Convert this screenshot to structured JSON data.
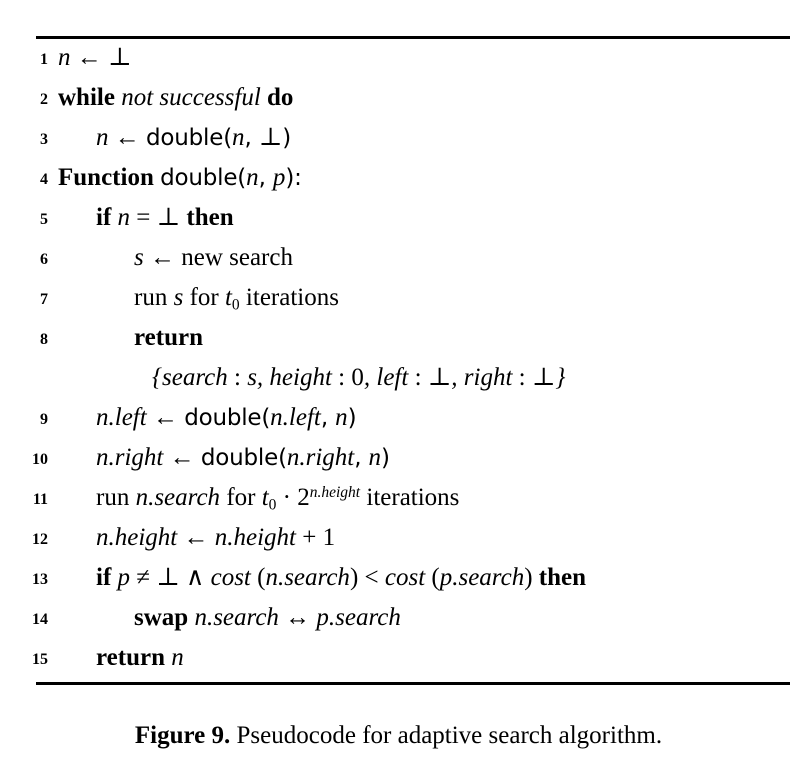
{
  "figure": {
    "caption_label": "Figure 9.",
    "caption_text": "Pseudocode for adaptive search algorithm.",
    "rule_color": "#000000"
  },
  "algorithm": {
    "lines": [
      {
        "number": "1",
        "indent": 0,
        "plain": "n ← ⊥",
        "tokens": [
          {
            "t": "var",
            "v": "n"
          },
          {
            "t": "op",
            "v": " ← "
          },
          {
            "t": "op",
            "v": "⊥"
          }
        ]
      },
      {
        "number": "2",
        "indent": 0,
        "plain": "while not successful do",
        "tokens": [
          {
            "t": "kw",
            "v": "while"
          },
          {
            "t": "rom",
            "v": " "
          },
          {
            "t": "var",
            "v": "not successful"
          },
          {
            "t": "rom",
            "v": " "
          },
          {
            "t": "kw",
            "v": "do"
          }
        ]
      },
      {
        "number": "3",
        "indent": 1,
        "plain": "n ← double(n, ⊥)",
        "tokens": [
          {
            "t": "var",
            "v": "n"
          },
          {
            "t": "op",
            "v": " ← "
          },
          {
            "t": "fn",
            "v": "double("
          },
          {
            "t": "var",
            "v": "n"
          },
          {
            "t": "fn",
            "v": ", "
          },
          {
            "t": "op",
            "v": "⊥"
          },
          {
            "t": "fn",
            "v": ")"
          }
        ]
      },
      {
        "number": "4",
        "indent": 0,
        "plain": "Function double(n, p):",
        "tokens": [
          {
            "t": "kw",
            "v": "Function"
          },
          {
            "t": "rom",
            "v": " "
          },
          {
            "t": "fn",
            "v": "double("
          },
          {
            "t": "var",
            "v": "n"
          },
          {
            "t": "fn",
            "v": ", "
          },
          {
            "t": "var",
            "v": "p"
          },
          {
            "t": "fn",
            "v": "):"
          }
        ]
      },
      {
        "number": "5",
        "indent": 1,
        "plain": "if n = ⊥ then",
        "tokens": [
          {
            "t": "kw",
            "v": "if"
          },
          {
            "t": "rom",
            "v": " "
          },
          {
            "t": "var",
            "v": "n"
          },
          {
            "t": "op",
            "v": " = "
          },
          {
            "t": "op",
            "v": "⊥"
          },
          {
            "t": "rom",
            "v": " "
          },
          {
            "t": "kw",
            "v": "then"
          }
        ]
      },
      {
        "number": "6",
        "indent": 2,
        "plain": "s ← new search",
        "tokens": [
          {
            "t": "var",
            "v": "s"
          },
          {
            "t": "op",
            "v": " ← "
          },
          {
            "t": "rom",
            "v": "new search"
          }
        ]
      },
      {
        "number": "7",
        "indent": 2,
        "plain": "run s for t₀ iterations",
        "tokens": [
          {
            "t": "rom",
            "v": "run "
          },
          {
            "t": "var",
            "v": "s"
          },
          {
            "t": "rom",
            "v": " for "
          },
          {
            "t": "var",
            "v": "t"
          },
          {
            "t": "sub",
            "v": "0"
          },
          {
            "t": "rom",
            "v": " iterations"
          }
        ]
      },
      {
        "number": "8",
        "indent": 2,
        "plain": "return",
        "tokens": [
          {
            "t": "kw",
            "v": "return"
          }
        ]
      },
      {
        "number": "",
        "indent": "2b",
        "continuation": true,
        "plain": "{search : s, height : 0, left : ⊥, right : ⊥}",
        "tokens": [
          {
            "t": "var",
            "v": "{search"
          },
          {
            "t": "op",
            "v": " : "
          },
          {
            "t": "var",
            "v": "s"
          },
          {
            "t": "var",
            "v": ", "
          },
          {
            "t": "var",
            "v": "height"
          },
          {
            "t": "op",
            "v": " : "
          },
          {
            "t": "num",
            "v": "0"
          },
          {
            "t": "var",
            "v": ", "
          },
          {
            "t": "var",
            "v": "left"
          },
          {
            "t": "op",
            "v": " : "
          },
          {
            "t": "op",
            "v": "⊥"
          },
          {
            "t": "var",
            "v": ", "
          },
          {
            "t": "var",
            "v": "right"
          },
          {
            "t": "op",
            "v": " : "
          },
          {
            "t": "op",
            "v": "⊥"
          },
          {
            "t": "var",
            "v": "}"
          }
        ]
      },
      {
        "number": "9",
        "indent": 1,
        "plain": "n.left ← double(n.left, n)",
        "tokens": [
          {
            "t": "var",
            "v": "n.left"
          },
          {
            "t": "op",
            "v": " ← "
          },
          {
            "t": "fn",
            "v": "double("
          },
          {
            "t": "var",
            "v": "n.left"
          },
          {
            "t": "fn",
            "v": ", "
          },
          {
            "t": "var",
            "v": "n"
          },
          {
            "t": "fn",
            "v": ")"
          }
        ]
      },
      {
        "number": "10",
        "indent": 1,
        "plain": "n.right ← double(n.right, n)",
        "tokens": [
          {
            "t": "var",
            "v": "n.right"
          },
          {
            "t": "op",
            "v": " ← "
          },
          {
            "t": "fn",
            "v": "double("
          },
          {
            "t": "var",
            "v": "n.right"
          },
          {
            "t": "fn",
            "v": ", "
          },
          {
            "t": "var",
            "v": "n"
          },
          {
            "t": "fn",
            "v": ")"
          }
        ]
      },
      {
        "number": "11",
        "indent": 1,
        "plain": "run n.search for t₀ · 2^{n.height} iterations",
        "tokens": [
          {
            "t": "rom",
            "v": "run "
          },
          {
            "t": "var",
            "v": "n.search"
          },
          {
            "t": "rom",
            "v": " for "
          },
          {
            "t": "var",
            "v": "t"
          },
          {
            "t": "sub",
            "v": "0"
          },
          {
            "t": "op",
            "v": " · "
          },
          {
            "t": "num",
            "v": "2"
          },
          {
            "t": "sup",
            "v": "n.height"
          },
          {
            "t": "rom",
            "v": " iterations"
          }
        ]
      },
      {
        "number": "12",
        "indent": 1,
        "plain": "n.height ← n.height + 1",
        "tokens": [
          {
            "t": "var",
            "v": "n.height"
          },
          {
            "t": "op",
            "v": " ← "
          },
          {
            "t": "var",
            "v": "n.height"
          },
          {
            "t": "op",
            "v": " + "
          },
          {
            "t": "num",
            "v": "1"
          }
        ]
      },
      {
        "number": "13",
        "indent": 1,
        "plain": "if p ≠ ⊥ ∧ cost(n.search) < cost(p.search) then",
        "tokens": [
          {
            "t": "kw",
            "v": "if"
          },
          {
            "t": "rom",
            "v": " "
          },
          {
            "t": "var",
            "v": "p"
          },
          {
            "t": "op",
            "v": " ≠ "
          },
          {
            "t": "op",
            "v": "⊥"
          },
          {
            "t": "op",
            "v": " ∧ "
          },
          {
            "t": "var",
            "v": "cost"
          },
          {
            "t": "op",
            "v": " ("
          },
          {
            "t": "var",
            "v": "n.search"
          },
          {
            "t": "op",
            "v": ")"
          },
          {
            "t": "op",
            "v": " < "
          },
          {
            "t": "var",
            "v": "cost"
          },
          {
            "t": "op",
            "v": " ("
          },
          {
            "t": "var",
            "v": "p.search"
          },
          {
            "t": "op",
            "v": ")"
          },
          {
            "t": "rom",
            "v": " "
          },
          {
            "t": "kw",
            "v": "then"
          }
        ]
      },
      {
        "number": "14",
        "indent": 2,
        "plain": "swap n.search ↔ p.search",
        "tokens": [
          {
            "t": "kw",
            "v": "swap"
          },
          {
            "t": "rom",
            "v": " "
          },
          {
            "t": "var",
            "v": "n.search"
          },
          {
            "t": "op",
            "v": " ↔ "
          },
          {
            "t": "var",
            "v": "p.search"
          }
        ]
      },
      {
        "number": "15",
        "indent": 1,
        "plain": "return n",
        "tokens": [
          {
            "t": "kw",
            "v": "return"
          },
          {
            "t": "rom",
            "v": " "
          },
          {
            "t": "var",
            "v": "n"
          }
        ]
      }
    ]
  }
}
